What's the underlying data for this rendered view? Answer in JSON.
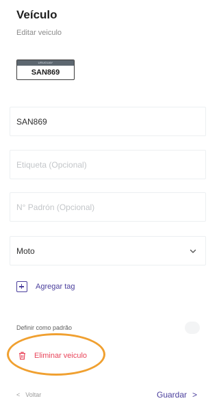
{
  "header": {
    "title": "Veículo",
    "subtitle": "Editar veiculo"
  },
  "plate": {
    "country": "URUGUAY",
    "number": "SAN869"
  },
  "form": {
    "plate_value": "SAN869",
    "label_placeholder": "Etiqueta (Opcional)",
    "registry_placeholder": "N° Padrón (Opcional)",
    "vehicle_type_selected": "Moto"
  },
  "actions": {
    "add_tag_label": "Agregar tag",
    "default_label": "Definir como padrão",
    "delete_label": "Eliminar veiculo"
  },
  "footer": {
    "back_label": "Voltar",
    "save_label": "Guardar"
  },
  "colors": {
    "accent": "#4a3e9c",
    "danger": "#e8445a",
    "highlight": "#f0a030"
  }
}
